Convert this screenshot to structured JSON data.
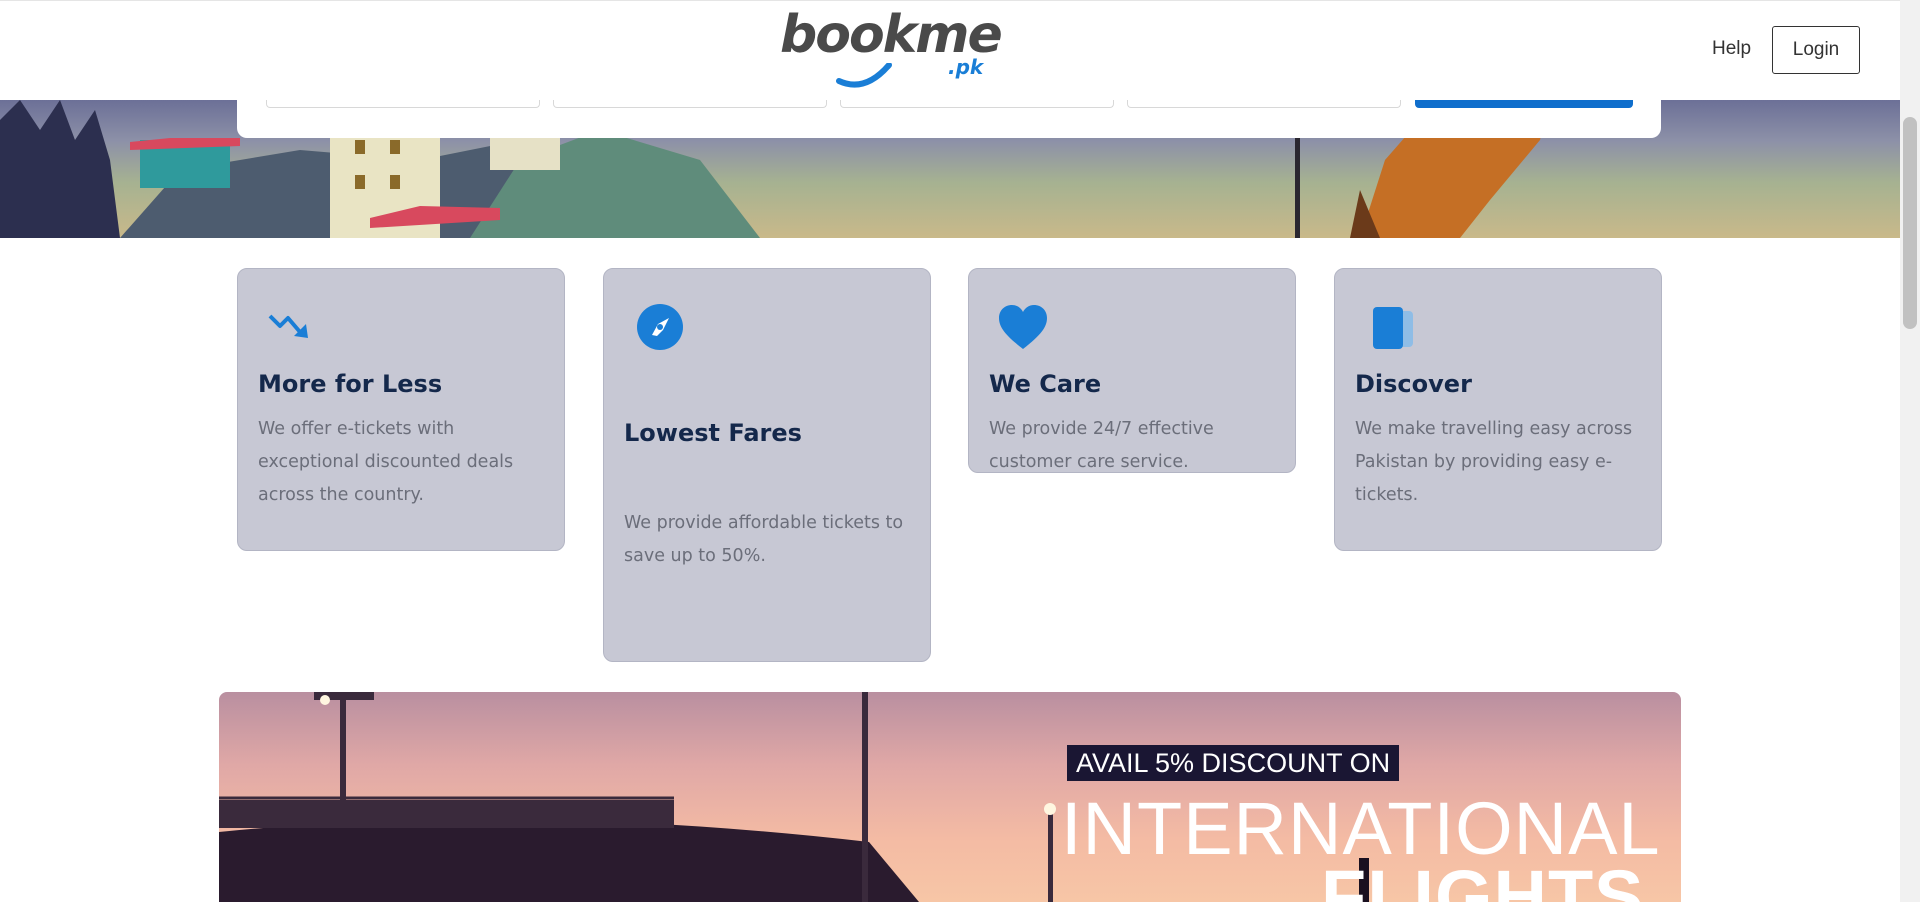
{
  "header": {
    "logo_text": "bookme",
    "logo_suffix": ".pk",
    "help_label": "Help",
    "login_label": "Login"
  },
  "features": [
    {
      "icon": "trending-down-icon",
      "title": "More for Less",
      "description": "We offer e-tickets with exceptional discounted deals across the country."
    },
    {
      "icon": "compass-icon",
      "title": "Lowest Fares",
      "description": "We provide affordable tickets to save up to 50%."
    },
    {
      "icon": "heart-icon",
      "title": "We Care",
      "description": "We provide 24/7 effective customer care service."
    },
    {
      "icon": "ticket-stack-icon",
      "title": "Discover",
      "description": "We make travelling easy across Pakistan by providing easy e-tickets."
    }
  ],
  "banner": {
    "tagline": "AVAIL 5% DISCOUNT ON",
    "headline_line1": "INTERNATIONAL",
    "headline_line2": "FLIGHTS"
  },
  "colors": {
    "brand_blue": "#0f6ecc",
    "card_bg": "#c7c8d4",
    "title_navy": "#14284b",
    "body_gray": "#6b6e7a"
  }
}
